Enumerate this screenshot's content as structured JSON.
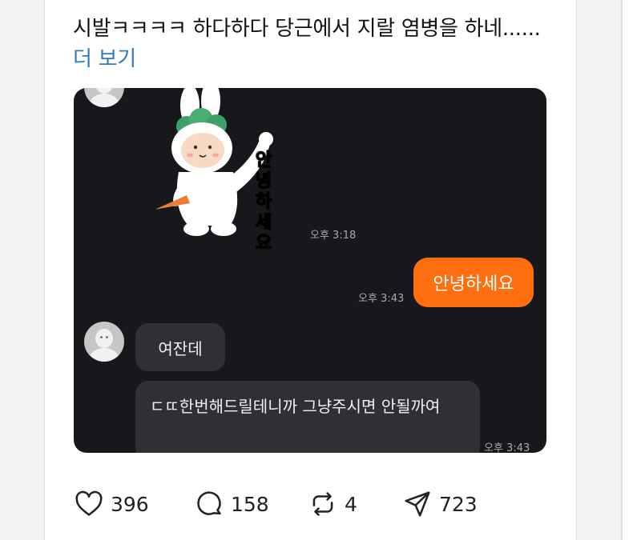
{
  "post": {
    "text_main": "시발ㅋㅋㅋㅋ 하다하다 당근에서 지랄 염병을 하네......",
    "more_label": "더 보기"
  },
  "chat": {
    "sticker_text": "안녕하세요",
    "time_1": "오후 3:18",
    "my_message": "안녕하세요",
    "time_2": "오후 3:43",
    "reply_1": "여잔데",
    "reply_2": "ㄷㄸ한번해드릴테니까 그냥주시면 안될까여",
    "time_3": "오후 3:43"
  },
  "actions": {
    "likes": "396",
    "comments": "158",
    "reposts": "4",
    "shares": "723"
  },
  "colors": {
    "chat_background": "#17181b",
    "my_bubble": "#ff6f0f",
    "their_bubble": "#2e3034",
    "link": "#2b7cc4"
  },
  "icons": [
    "heart-icon",
    "comment-icon",
    "repost-icon",
    "share-icon",
    "avatar-icon",
    "bunny-sticker"
  ]
}
